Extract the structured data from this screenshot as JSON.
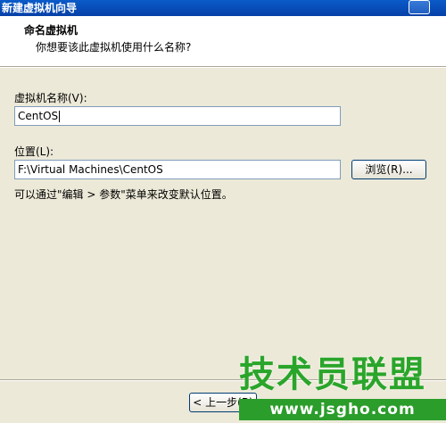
{
  "window": {
    "title": "新建虚拟机向导"
  },
  "header": {
    "title": "命名虚拟机",
    "subtitle": "你想要该此虚拟机使用什么名称?"
  },
  "form": {
    "name_label": "虚拟机名称(V):",
    "name_value": "CentOS",
    "location_label": "位置(L):",
    "location_value": "F:\\Virtual Machines\\CentOS",
    "browse_label": "浏览(R)...",
    "hint": "可以通过\"编辑 > 参数\"菜单来改变默认位置。"
  },
  "footer": {
    "back_label": "< 上一步(B)"
  },
  "watermark": {
    "main": "技术员联盟",
    "url": "www.jsgho.com"
  }
}
